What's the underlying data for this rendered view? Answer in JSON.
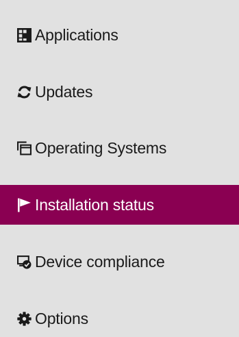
{
  "nav": {
    "items": [
      {
        "label": "Applications",
        "icon": "applications-grid-icon",
        "active": false
      },
      {
        "label": "Updates",
        "icon": "refresh-icon",
        "active": false
      },
      {
        "label": "Operating Systems",
        "icon": "windows-stack-icon",
        "active": false
      },
      {
        "label": "Installation status",
        "icon": "flag-icon",
        "active": true
      },
      {
        "label": "Device compliance",
        "icon": "device-check-icon",
        "active": false
      },
      {
        "label": "Options",
        "icon": "gear-icon",
        "active": false
      }
    ]
  },
  "colors": {
    "background": "#e1e1e1",
    "active_background": "#8a0052",
    "active_text": "#ffffff",
    "text": "#1a1a1a"
  }
}
